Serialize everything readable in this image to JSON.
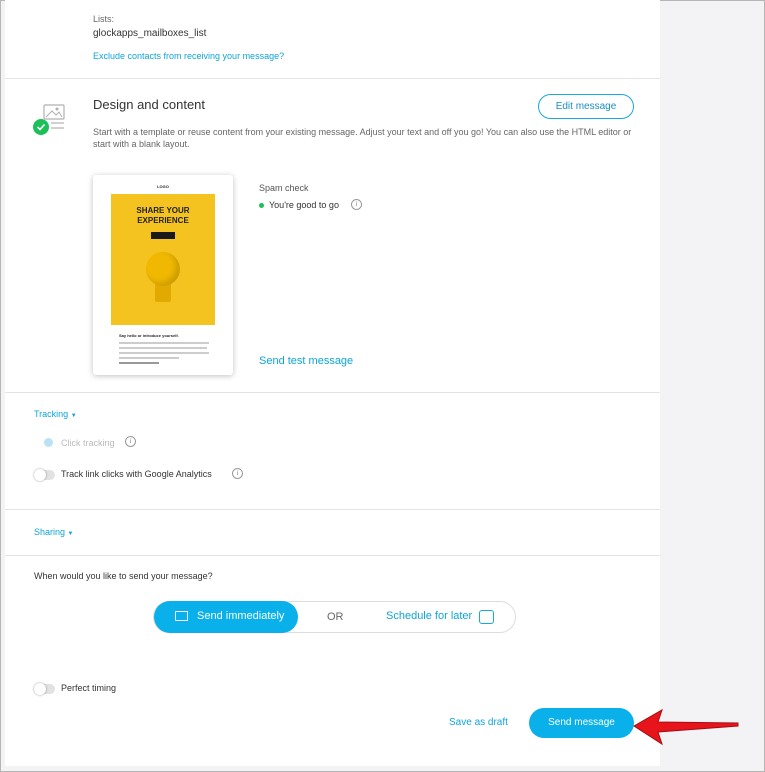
{
  "recipients": {
    "lists_label": "Lists:",
    "lists_value": "glockapps_mailboxes_list",
    "exclude_link": "Exclude contacts from receiving your message?"
  },
  "design": {
    "title": "Design and content",
    "edit_button": "Edit message",
    "description": "Start with a template or reuse content from your existing message. Adjust your text and off you go! You can also use the HTML editor or start with a blank layout.",
    "preview": {
      "logo": "LOGO",
      "headline": "SHARE YOUR EXPERIENCE",
      "intro": "Say hello or introduce yourself."
    },
    "status_color": "#1dbf5a"
  },
  "spam_check": {
    "label": "Spam check",
    "status": "You're good to go",
    "status_color": "#1dbf5a",
    "info_icon": "info-icon"
  },
  "send_test_link": "Send test message",
  "tracking": {
    "toggle_label": "Tracking",
    "click_tracking_label": "Click tracking",
    "google_analytics_label": "Track link clicks with Google Analytics",
    "google_analytics_enabled": false
  },
  "sharing": {
    "toggle_label": "Sharing"
  },
  "schedule": {
    "question": "When would you like to send your message?",
    "send_immediately": "Send immediately",
    "or_label": "OR",
    "schedule_later": "Schedule for later",
    "selected": "send_immediately"
  },
  "perfect_timing": {
    "label": "Perfect timing",
    "enabled": false
  },
  "footer": {
    "save_draft": "Save as draft",
    "send_message": "Send message"
  },
  "colors": {
    "accent": "#0ab0ea",
    "link": "#0ea5d8",
    "annotation_arrow": "#e8141c"
  }
}
